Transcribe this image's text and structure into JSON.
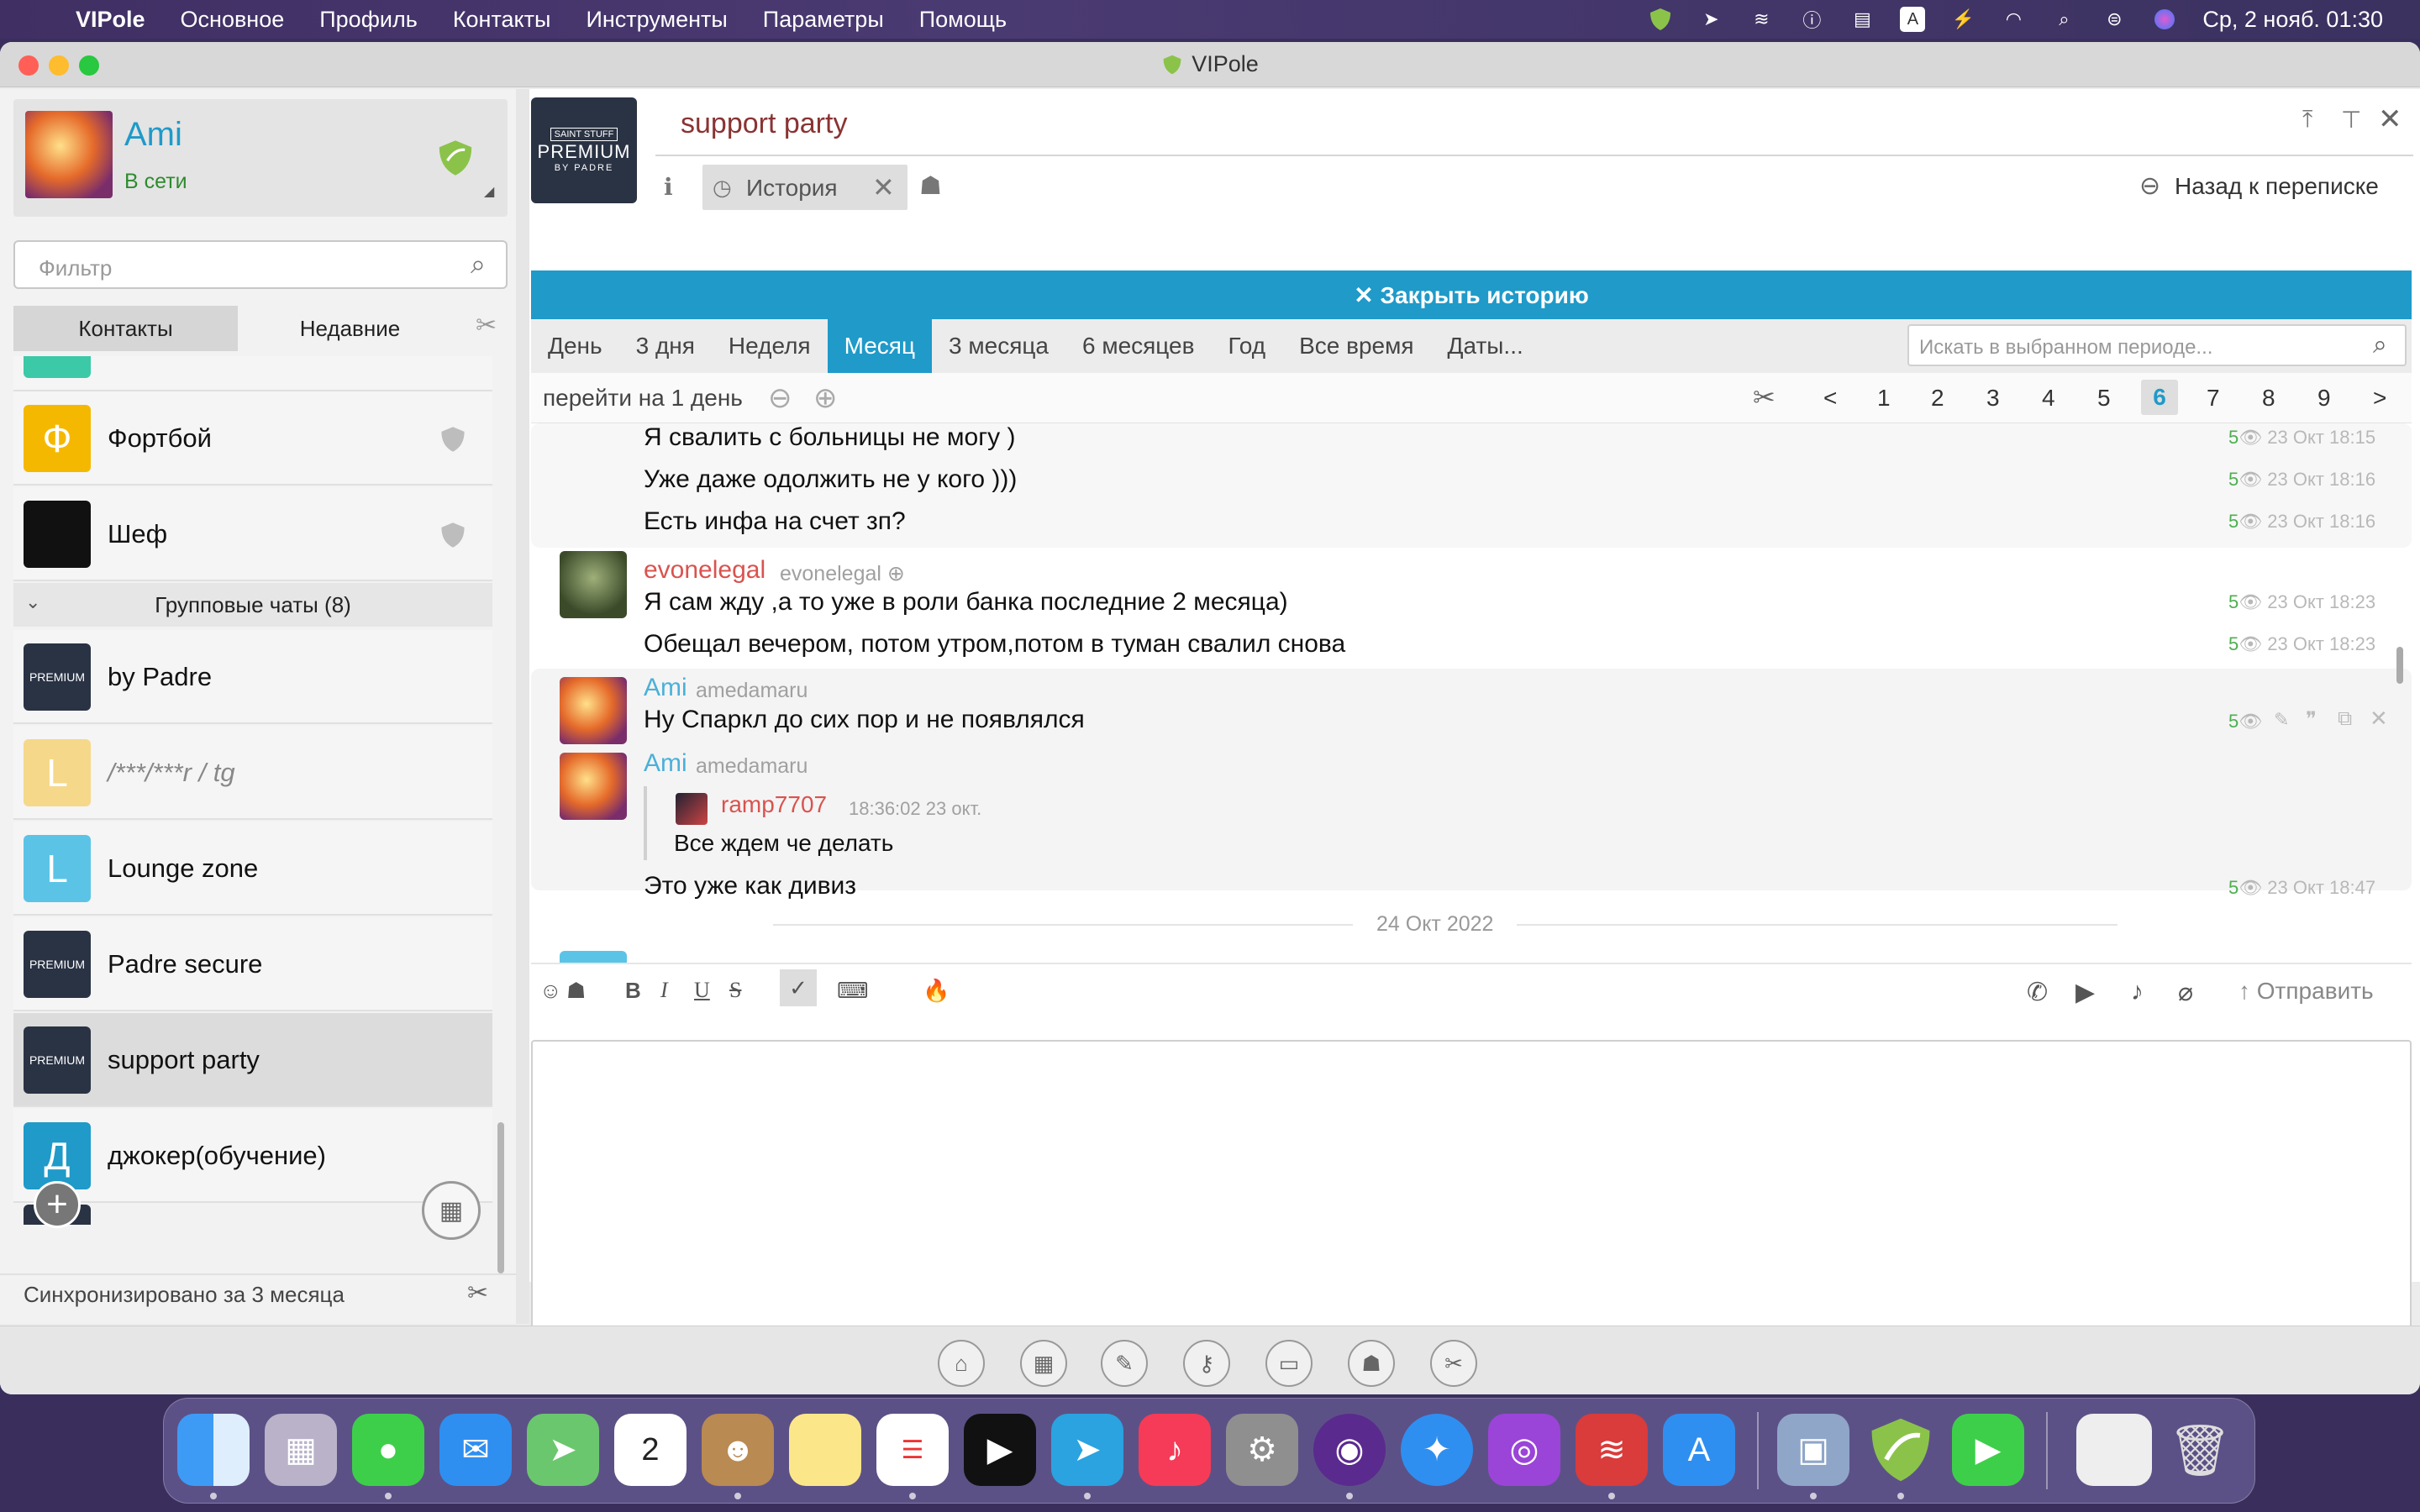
{
  "menubar": {
    "app_name": "VIPole",
    "items": [
      "Основное",
      "Профиль",
      "Контакты",
      "Инструменты",
      "Параметры",
      "Помощь"
    ],
    "clock": "Ср, 2 нояб. 01:30",
    "keyboard_layout": "A"
  },
  "window": {
    "title": "VIPole"
  },
  "profile": {
    "name": "Ami",
    "status": "В сети"
  },
  "filter": {
    "placeholder": "Фильтр"
  },
  "left_tabs": {
    "contacts": "Контакты",
    "recent": "Недавние"
  },
  "contacts": [
    {
      "name": "Фортбой",
      "letter": "Ф",
      "color": "#f5b800"
    },
    {
      "name": "Шеф",
      "letter": "",
      "color": "#111111"
    }
  ],
  "group_header": "Групповые чаты (8)",
  "groups": [
    {
      "name": "by Padre",
      "letter": "",
      "color": "#2a3344"
    },
    {
      "name": "/***/***r / tg",
      "letter": "L",
      "color": "#f5d88a"
    },
    {
      "name": "Lounge zone",
      "letter": "L",
      "color": "#5bc4e6"
    },
    {
      "name": "Padre secure",
      "letter": "",
      "color": "#2a3344"
    },
    {
      "name": "support party",
      "letter": "",
      "color": "#2a3344"
    },
    {
      "name": "джокер(обучение)",
      "letter": "Д",
      "color": "#1f9ac9"
    }
  ],
  "sync_status": "Синхронизировано за 3 месяца",
  "premium_badge": {
    "small": "SAINT STUFF",
    "big": "PREMIUM",
    "sub": "BY PADRE"
  },
  "chat": {
    "title": "support party",
    "history_tab": "История",
    "back": "Назад к переписке",
    "close_history": "✕ Закрыть историю",
    "periods": [
      "День",
      "3 дня",
      "Неделя",
      "Месяц",
      "3 месяца",
      "6 месяцев",
      "Год",
      "Все время",
      "Даты..."
    ],
    "active_period": "Месяц",
    "search_placeholder": "Искать в выбранном периоде...",
    "jump_label": "перейти на 1 день",
    "pages": [
      "<",
      "1",
      "2",
      "3",
      "4",
      "5",
      "6",
      "7",
      "8",
      "9",
      ">"
    ],
    "current_page": "6",
    "messages": [
      {
        "text": "Я свалить с больницы не могу )",
        "time": "23 Окт 18:15"
      },
      {
        "text": "Уже даже одолжить не у кого )))",
        "time": "23 Окт 18:16"
      },
      {
        "text": "Есть инфа на счет зп?",
        "time": "23 Окт 18:16"
      },
      {
        "author": "evonelegal",
        "login": "evonelegal",
        "text": "Я сам жду ,а то уже в роли банка последние 2 месяца)",
        "time": "23 Окт 18:23"
      },
      {
        "text": "Обещал вечером, потом утром,потом в туман свалил снова",
        "time": "23 Окт 18:23"
      },
      {
        "author": "Ami",
        "login": "amedamaru",
        "text": "Ну Спаркл до сих пор и не появлялся",
        "time": ""
      },
      {
        "author": "Ami",
        "login": "amedamaru",
        "quote_author": "ramp7707",
        "quote_time": "18:36:02 23 окт.",
        "quote_text": "Все ждем че делать",
        "text": "Это уже как дивиз",
        "time": "23 Окт 18:47"
      }
    ],
    "read_mark": "5",
    "date_separator": "24 Окт 2022",
    "send": "Отправить"
  }
}
